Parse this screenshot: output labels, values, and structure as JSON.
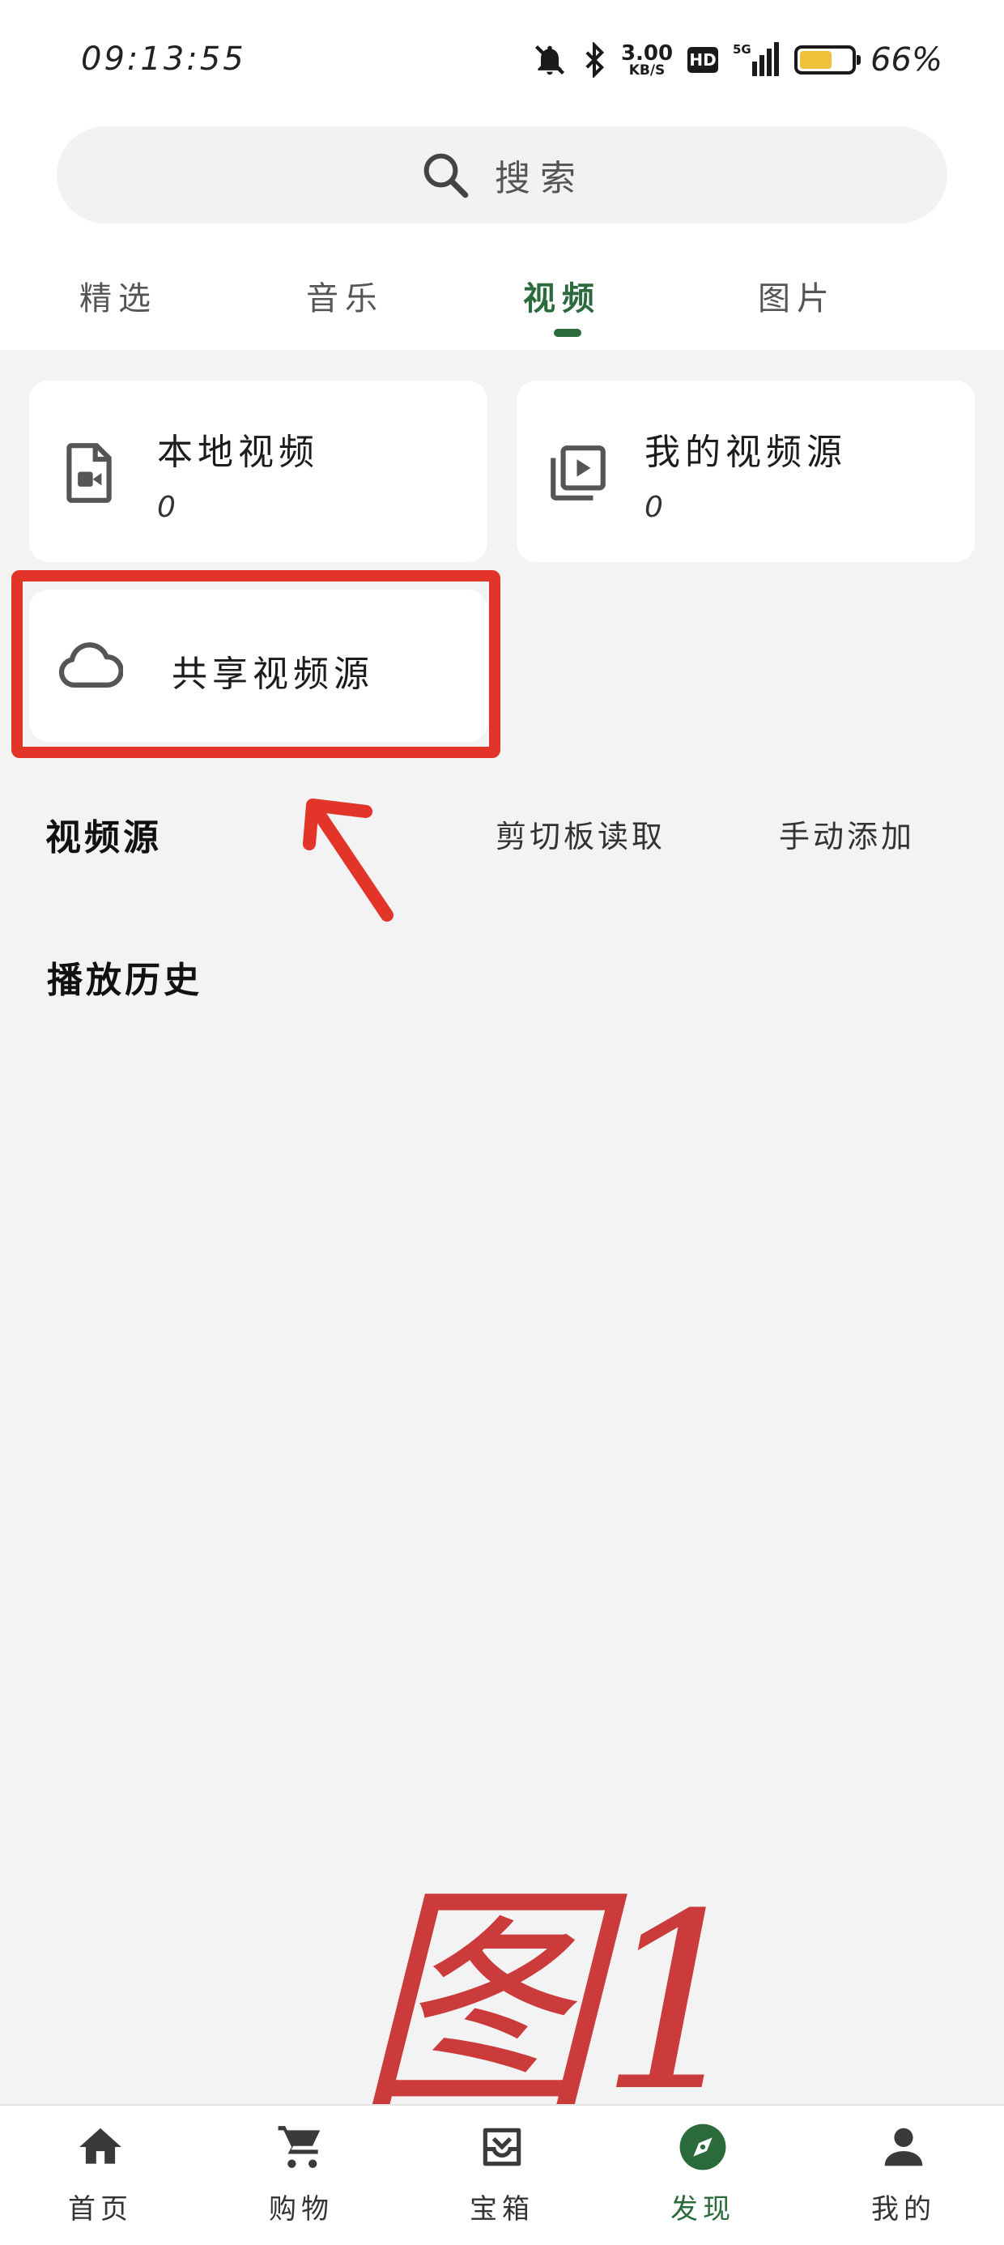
{
  "status_bar": {
    "time": "09:13:55",
    "net_speed": "3.00",
    "net_unit": "KB/S",
    "hd_badge": "HD",
    "signal_label": "5G",
    "battery_percent": 66,
    "battery_text": "66%"
  },
  "search": {
    "placeholder": "搜索"
  },
  "tabs": [
    {
      "label": "精选",
      "active": false
    },
    {
      "label": "音乐",
      "active": false
    },
    {
      "label": "视频",
      "active": true
    },
    {
      "label": "图片",
      "active": false
    }
  ],
  "cards": {
    "local_video": {
      "title": "本地视频",
      "count": "0",
      "icon": "video-file-icon"
    },
    "my_sources": {
      "title": "我的视频源",
      "count": "0",
      "icon": "video-library-icon"
    },
    "shared_sources": {
      "title": "共享视频源",
      "icon": "cloud-icon"
    }
  },
  "video_sources": {
    "title": "视频源",
    "clipboard_action": "剪切板读取",
    "manual_action": "手动添加"
  },
  "history": {
    "title": "播放历史"
  },
  "annotation": {
    "text": "图1",
    "color": "#e3342a"
  },
  "bottom_nav": [
    {
      "label": "首页",
      "icon": "home-icon",
      "active": false
    },
    {
      "label": "购物",
      "icon": "cart-icon",
      "active": false
    },
    {
      "label": "宝箱",
      "icon": "inbox-icon",
      "active": false
    },
    {
      "label": "发现",
      "icon": "compass-icon",
      "active": true
    },
    {
      "label": "我的",
      "icon": "person-icon",
      "active": false
    }
  ],
  "colors": {
    "accent": "#2b6a3b",
    "highlight": "#e3342a",
    "battery": "#f2c13b"
  }
}
